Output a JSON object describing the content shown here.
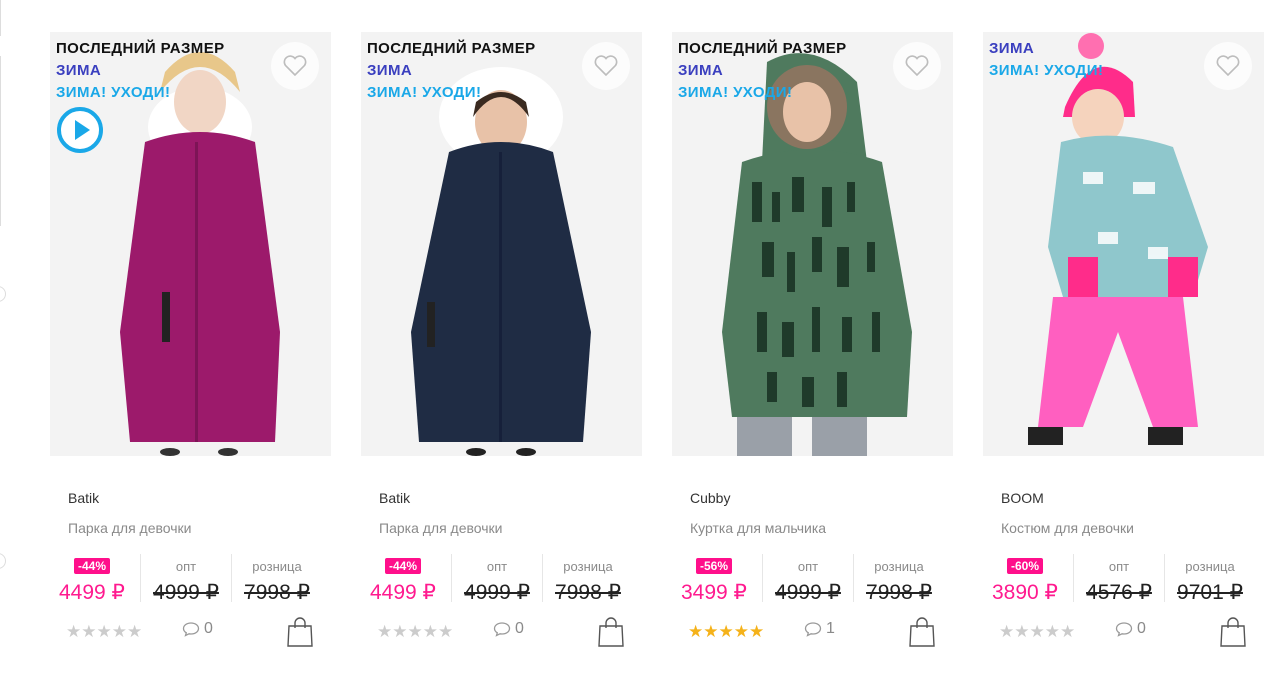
{
  "products": [
    {
      "labels": [
        "ПОСЛЕДНИЙ РАЗМЕР",
        "ЗИМА",
        "ЗИМА! УХОДИ!"
      ],
      "has_video": true,
      "brand": "Batik",
      "description": "Парка для девочки",
      "discount": "-44%",
      "price_sale": "4499 ₽",
      "opt_label": "опт",
      "price_opt": "4999 ₽",
      "retail_label": "розница",
      "price_retail": "7998 ₽",
      "rating": 0,
      "stars": "★★★★★",
      "comments": "0",
      "coat_color": "#9c1a6b",
      "hood_color": "#ffffff"
    },
    {
      "labels": [
        "ПОСЛЕДНИЙ РАЗМЕР",
        "ЗИМА",
        "ЗИМА! УХОДИ!"
      ],
      "has_video": false,
      "brand": "Batik",
      "description": "Парка для девочки",
      "discount": "-44%",
      "price_sale": "4499 ₽",
      "opt_label": "опт",
      "price_opt": "4999 ₽",
      "retail_label": "розница",
      "price_retail": "7998 ₽",
      "rating": 0,
      "stars": "★★★★★",
      "comments": "0",
      "coat_color": "#1f2c44",
      "hood_color": "#f7f7f7"
    },
    {
      "labels": [
        "ПОСЛЕДНИЙ РАЗМЕР",
        "ЗИМА",
        "ЗИМА! УХОДИ!"
      ],
      "has_video": false,
      "brand": "Cubby",
      "description": "Куртка для мальчика",
      "discount": "-56%",
      "price_sale": "3499 ₽",
      "opt_label": "опт",
      "price_opt": "4999 ₽",
      "retail_label": "розница",
      "price_retail": "7998 ₽",
      "rating": 5,
      "stars": "★★★★★",
      "comments": "1",
      "coat_color": "#4f7a5e",
      "hood_color": "#8a7560"
    },
    {
      "labels": [
        "ЗИМА",
        "ЗИМА! УХОДИ!"
      ],
      "has_video": false,
      "brand": "BOOM",
      "description": "Костюм для девочки",
      "discount": "-60%",
      "price_sale": "3890 ₽",
      "opt_label": "опт",
      "price_opt": "4576 ₽",
      "retail_label": "розница",
      "price_retail": "9701 ₽",
      "rating": 0,
      "stars": "★★★★★",
      "comments": "0",
      "coat_color": "#8fc7cc",
      "hood_color": "#ff2c8a"
    }
  ],
  "colors": {
    "accent_pink": "#ff1a8f",
    "label_winter": "#3a3fbf",
    "label_sale": "#1aa8e8",
    "star_active": "#f5b21a",
    "star_inactive": "#cccccc"
  }
}
